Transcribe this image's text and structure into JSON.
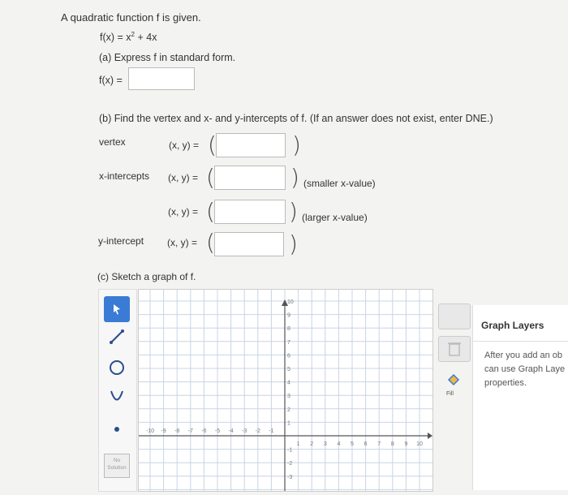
{
  "problem": {
    "intro": "A quadratic function f is given.",
    "function": "f(x) = x",
    "function_exp": "2",
    "function_rest": " + 4x"
  },
  "part_a": {
    "prompt": "(a) Express f in standard form.",
    "label": "f(x) =",
    "answer": ""
  },
  "part_b": {
    "prompt": "(b) Find the vertex and x- and y-intercepts of f. (If an answer does not exist, enter DNE.)",
    "rows": [
      {
        "label": "vertex",
        "xy": "(x, y) =",
        "hint": "",
        "answer": ""
      },
      {
        "label": "x-intercepts",
        "xy": "(x, y) =",
        "hint": "(smaller x-value)",
        "answer": ""
      },
      {
        "label": "",
        "xy": "(x, y) =",
        "hint": "(larger x-value)",
        "answer": ""
      },
      {
        "label": "y-intercept",
        "xy": "(x, y) =",
        "hint": "",
        "answer": ""
      }
    ],
    "open_paren": "(",
    "close_paren": ")"
  },
  "part_c": {
    "prompt": "(c) Sketch a graph of f."
  },
  "toolbar": {
    "tools": [
      "pointer-icon",
      "line-icon",
      "circle-icon",
      "parabola-icon",
      "point-icon"
    ],
    "no_solution": "No Solution",
    "accent": "#3a7bd5"
  },
  "graph": {
    "x_ticks": [
      "-10",
      "-9",
      "-8",
      "-7",
      "-6",
      "-5",
      "-4",
      "-3",
      "-2",
      "-1",
      "1",
      "2",
      "3",
      "4",
      "5",
      "6",
      "7",
      "8",
      "9",
      "10"
    ],
    "y_ticks": [
      "10",
      "9",
      "8",
      "7",
      "6",
      "5",
      "4",
      "3",
      "2",
      "1",
      "-1",
      "-2",
      "-3"
    ]
  },
  "side": {
    "fill_label": "Fill"
  },
  "layers": {
    "title": "Graph Layers",
    "line1": "After you add an ob",
    "line2": "can use Graph Laye",
    "line3": "properties."
  }
}
